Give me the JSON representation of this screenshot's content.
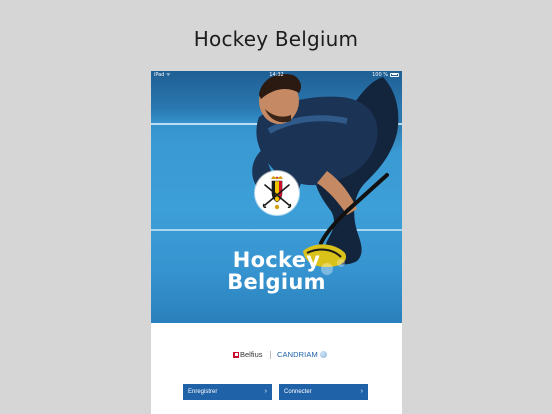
{
  "page": {
    "title": "Hockey Belgium"
  },
  "device": {
    "statusbar": {
      "left": "iPad ᯤ",
      "time": "14:32",
      "battery": "100 %"
    },
    "hero": {
      "title_line1": "Hockey",
      "title_line2": "Belgium"
    },
    "sponsors": {
      "sponsor1": "Belfius",
      "sponsor2": "CANDRIAM"
    },
    "buttons": {
      "register": "Enregistrer",
      "connect": "Connecter",
      "chevron": "›"
    }
  },
  "colors": {
    "hero_blue": "#3a9ad3",
    "button_blue": "#1f62a8",
    "belfius_red": "#c8102e",
    "candriam_blue": "#1b5fa8",
    "background": "#d7d6d6"
  }
}
